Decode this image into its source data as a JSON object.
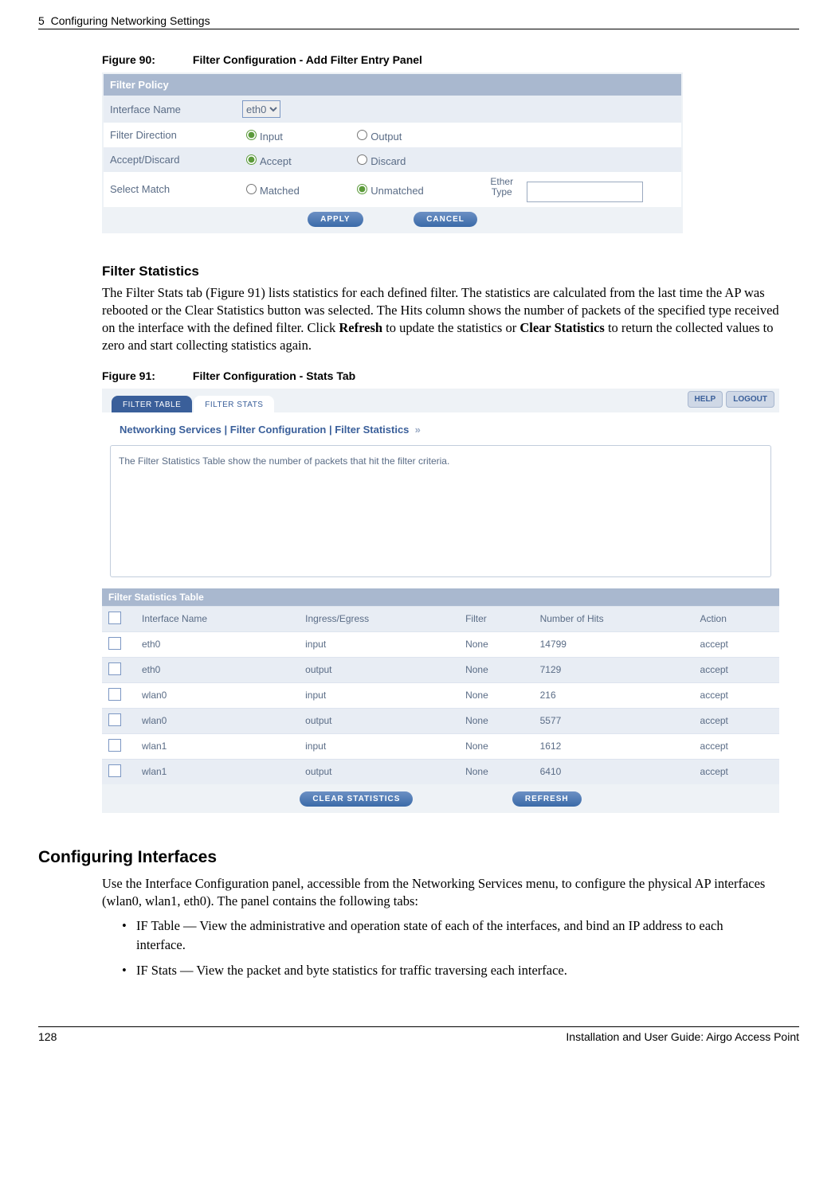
{
  "header": {
    "chapter": "5",
    "title": "Configuring Networking Settings"
  },
  "fig90": {
    "num": "Figure 90:",
    "title": "Filter Configuration - Add Filter Entry Panel"
  },
  "panel1": {
    "header": "Filter Policy",
    "rows": {
      "iface": {
        "label": "Interface Name",
        "value": "eth0"
      },
      "dir": {
        "label": "Filter Direction",
        "opt1": "Input",
        "opt2": "Output"
      },
      "ad": {
        "label": "Accept/Discard",
        "opt1": "Accept",
        "opt2": "Discard"
      },
      "match": {
        "label": "Select Match",
        "opt1": "Matched",
        "opt2": "Unmatched",
        "etype": "Ether Type"
      }
    },
    "apply": "APPLY",
    "cancel": "CANCEL"
  },
  "sect1": {
    "title": "Filter Statistics",
    "body": "The Filter Stats tab (Figure 91) lists statistics for each defined filter. The statistics are calculated from the last time the AP was rebooted or the Clear Statistics button was selected. The Hits column shows the number of packets of the specified type received on the interface with the defined filter. Click Refresh to update the statistics or Clear Statistics to return the collected values to zero and start collecting statistics again."
  },
  "fig91": {
    "num": "Figure 91:",
    "title": "Filter Configuration - Stats Tab"
  },
  "panel2": {
    "tabs": {
      "t1": "FILTER TABLE",
      "t2": "FILTER STATS"
    },
    "help": "HELP",
    "logout": "LOGOUT",
    "breadcrumb": "Networking Services | Filter Configuration | Filter Statistics",
    "desc": "The Filter Statistics Table show the number of packets that hit the filter criteria.",
    "tableTitle": "Filter Statistics Table",
    "cols": {
      "c1": "Interface Name",
      "c2": "Ingress/Egress",
      "c3": "Filter",
      "c4": "Number of Hits",
      "c5": "Action"
    },
    "chart_data": {
      "type": "table",
      "cols": [
        "Interface Name",
        "Ingress/Egress",
        "Filter",
        "Number of Hits",
        "Action"
      ],
      "rows": [
        {
          "iface": "eth0",
          "dir": "input",
          "filter": "None",
          "hits": "14799",
          "action": "accept"
        },
        {
          "iface": "eth0",
          "dir": "output",
          "filter": "None",
          "hits": "7129",
          "action": "accept"
        },
        {
          "iface": "wlan0",
          "dir": "input",
          "filter": "None",
          "hits": "216",
          "action": "accept"
        },
        {
          "iface": "wlan0",
          "dir": "output",
          "filter": "None",
          "hits": "5577",
          "action": "accept"
        },
        {
          "iface": "wlan1",
          "dir": "input",
          "filter": "None",
          "hits": "1612",
          "action": "accept"
        },
        {
          "iface": "wlan1",
          "dir": "output",
          "filter": "None",
          "hits": "6410",
          "action": "accept"
        }
      ]
    },
    "clear": "CLEAR STATISTICS",
    "refresh": "REFRESH"
  },
  "sect2": {
    "title": "Configuring Interfaces",
    "body": "Use the Interface Configuration panel, accessible from the Networking Services menu, to configure the physical AP interfaces (wlan0, wlan1, eth0). The panel contains the following tabs:",
    "b1": "IF Table — View the administrative and operation state of each of the interfaces, and bind an IP address to each interface.",
    "b2": "IF Stats — View the packet and byte statistics for traffic traversing each interface."
  },
  "footer": {
    "page": "128",
    "title": "Installation and User Guide: Airgo Access Point"
  }
}
